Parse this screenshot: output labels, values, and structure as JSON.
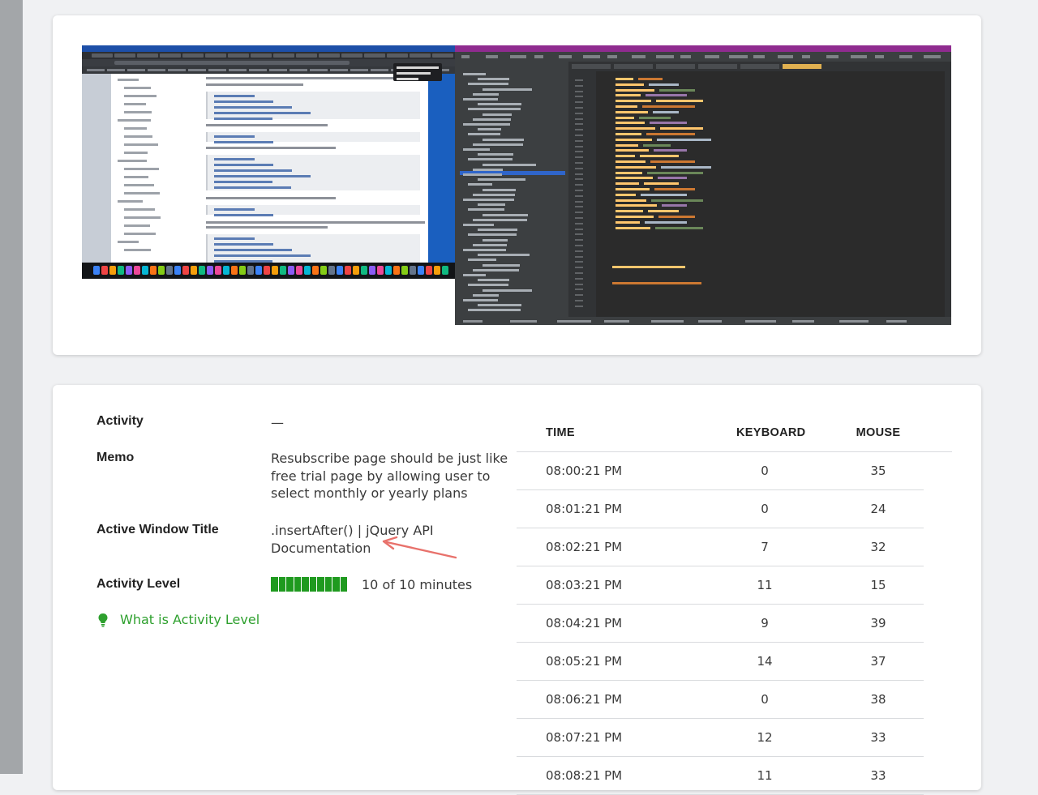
{
  "activity": {
    "rows": [
      {
        "label": "Activity",
        "value": "—"
      },
      {
        "label": "Memo",
        "value": "Resubscribe page should be just like free trial page by allowing user to select monthly or yearly plans"
      },
      {
        "label": "Active Window Title",
        "value": ".insertAfter() | jQuery API Documentation"
      },
      {
        "label": "Activity Level",
        "value": "10 of 10 minutes"
      }
    ],
    "level_filled": 10,
    "level_total": 10,
    "help_link": "What is Activity Level",
    "level_color": "#1f9a1f",
    "link_color": "#2ea02e",
    "annotation_color": "#e8716b"
  },
  "table": {
    "headers": [
      "TIME",
      "KEYBOARD",
      "MOUSE"
    ],
    "rows": [
      {
        "time": "08:00:21 PM",
        "keyboard": "0",
        "mouse": "35"
      },
      {
        "time": "08:01:21 PM",
        "keyboard": "0",
        "mouse": "24"
      },
      {
        "time": "08:02:21 PM",
        "keyboard": "7",
        "mouse": "32"
      },
      {
        "time": "08:03:21 PM",
        "keyboard": "11",
        "mouse": "15"
      },
      {
        "time": "08:04:21 PM",
        "keyboard": "9",
        "mouse": "39"
      },
      {
        "time": "08:05:21 PM",
        "keyboard": "14",
        "mouse": "37"
      },
      {
        "time": "08:06:21 PM",
        "keyboard": "0",
        "mouse": "38"
      },
      {
        "time": "08:07:21 PM",
        "keyboard": "12",
        "mouse": "33"
      },
      {
        "time": "08:08:21 PM",
        "keyboard": "11",
        "mouse": "33"
      }
    ]
  }
}
